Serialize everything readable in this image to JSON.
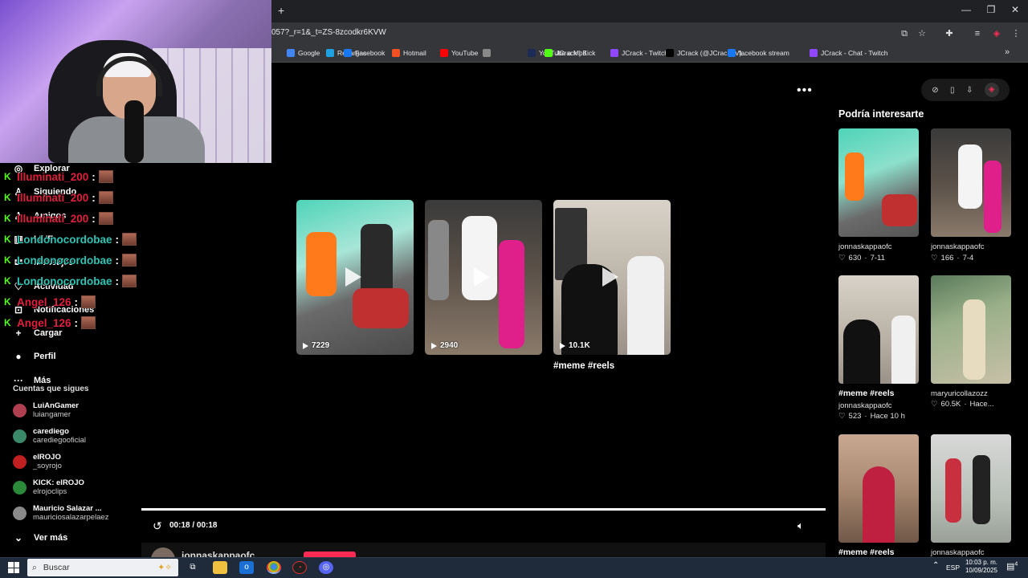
{
  "browser": {
    "new_tab_symbol": "+",
    "url": "057?_r=1&_t=ZS-8zcodkr6KVW",
    "window_buttons": [
      "—",
      "❐",
      "✕"
    ],
    "bookmarks": [
      {
        "label": "Google",
        "color": "#4285f4"
      },
      {
        "label": "Recargas",
        "color": "#1fa0e0"
      },
      {
        "label": "Facebook",
        "color": "#1877f2"
      },
      {
        "label": "Hotmail",
        "color": "#f25022"
      },
      {
        "label": "YouTube",
        "color": "#ff0000"
      },
      {
        "label": "",
        "color": "#888888"
      },
      {
        "label": "YouTube a Mp3",
        "color": "#1b2a56"
      },
      {
        "label": "JCrack | Kick",
        "color": "#53fc18"
      },
      {
        "label": "JCrack - Twitch",
        "color": "#9146ff"
      },
      {
        "label": "JCrack (@JCrackTV)...",
        "color": "#000000"
      },
      {
        "label": "facebook stream",
        "color": "#1877f2"
      },
      {
        "label": "JCrack - Chat - Twitch",
        "color": "#9146ff"
      }
    ],
    "overflow_symbol": "»"
  },
  "chat": [
    {
      "user": "Illuminati_200",
      "color": "#e0203a"
    },
    {
      "user": "Illuminati_200",
      "color": "#e0203a"
    },
    {
      "user": "Illuminati_200",
      "color": "#e0203a"
    },
    {
      "user": "Londonocordobae",
      "color": "#2ec4b6"
    },
    {
      "user": "Londonocordobae",
      "color": "#2ec4b6"
    },
    {
      "user": "Londonocordobae",
      "color": "#2ec4b6"
    },
    {
      "user": "Angel_126",
      "color": "#e0203a"
    },
    {
      "user": "Angel_126",
      "color": "#e0203a"
    }
  ],
  "chat_separator": ":",
  "sidebar": {
    "nav": [
      {
        "label": "Explorar",
        "icon": "compass-icon",
        "glyph": "◎"
      },
      {
        "label": "Siguiendo",
        "icon": "following-icon",
        "glyph": "♙"
      },
      {
        "label": "Amigos",
        "icon": "friends-icon",
        "glyph": "♙"
      },
      {
        "label": "LIVE",
        "icon": "live-icon",
        "glyph": "▣"
      },
      {
        "label": "Mensajes",
        "icon": "messages-icon",
        "glyph": "✉"
      },
      {
        "label": "Actividad",
        "icon": "activity-icon",
        "glyph": "♡"
      },
      {
        "label": "Notificaciones",
        "icon": "notifications-icon",
        "glyph": "⊡"
      },
      {
        "label": "Cargar",
        "icon": "upload-icon",
        "glyph": "+"
      },
      {
        "label": "Perfil",
        "icon": "profile-icon",
        "glyph": "●"
      },
      {
        "label": "Más",
        "icon": "more-icon",
        "glyph": "···"
      }
    ],
    "following_title": "Cuentas que sigues",
    "accounts": [
      {
        "name": "LuiAnGamer",
        "handle": "luiangamer",
        "color": "#b04050"
      },
      {
        "name": "carediego",
        "handle": "carediegooficial",
        "color": "#3a8a6a"
      },
      {
        "name": "elROJO",
        "handle": "_soyrojo",
        "color": "#c02020"
      },
      {
        "name": "KICK: elROJO",
        "handle": "elrojoclips",
        "color": "#2a8a3a"
      },
      {
        "name": "Mauricio Salazar ...",
        "handle": "mauriciosalazarpelaez",
        "color": "#8a8a8a"
      }
    ],
    "see_more": "Ver más"
  },
  "player": {
    "more": "•••",
    "related": [
      {
        "views": "7229"
      },
      {
        "views": "2940"
      },
      {
        "views": "10.1K"
      }
    ],
    "caption": "#meme #reels",
    "time": "00:18 / 00:18",
    "progress": 1.0,
    "author": "jonnaskappaofc"
  },
  "recommend": {
    "title": "Podría interesarte",
    "items": [
      {
        "caption": "",
        "author": "jonnaskappaofc",
        "likes": "630",
        "date": "7-11"
      },
      {
        "caption": "",
        "author": "jonnaskappaofc",
        "likes": "166",
        "date": "7-4"
      },
      {
        "caption": "#meme #reels",
        "author": "jonnaskappaofc",
        "likes": "523",
        "date": "Hace 10 h"
      },
      {
        "caption": "",
        "author": "maryuricollazozz",
        "likes": "60.5K",
        "date": "Hace..."
      },
      {
        "caption": "#meme #reels",
        "author": "",
        "likes": "",
        "date": ""
      },
      {
        "caption": "",
        "author": "jonnaskappaofc",
        "likes": "",
        "date": ""
      }
    ]
  },
  "taskbar": {
    "search_label": "Buscar",
    "language": "ESP",
    "time": "10:03 p. m.",
    "date": "10/09/2025",
    "notif_count": "4"
  }
}
